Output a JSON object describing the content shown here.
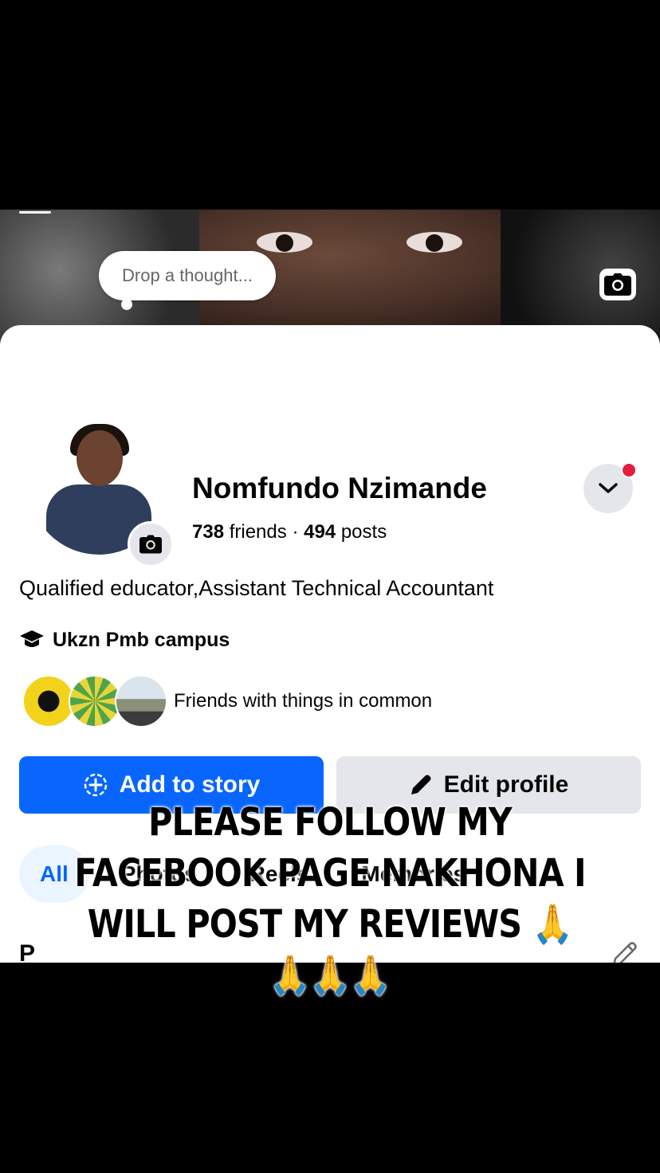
{
  "profile": {
    "thought_placeholder": "Drop a thought...",
    "name": "Nomfundo Nzimande",
    "friends_count": "738",
    "friends_label": "friends",
    "separator": "·",
    "posts_count": "494",
    "posts_label": "posts",
    "bio": "Qualified educator,Assistant Technical Accountant",
    "education": "Ukzn Pmb campus",
    "friends_in_common": "Friends with things in common"
  },
  "actions": {
    "add_story": "Add to story",
    "edit_profile": "Edit profile"
  },
  "tabs": [
    {
      "label": "All"
    },
    {
      "label": "Photos"
    },
    {
      "label": "Reels"
    },
    {
      "label": "Memories"
    }
  ],
  "section": {
    "title_partial": "P"
  },
  "overlay_text": "PLEASE FOLLOW MY FACEBOOK PAGE NAKHONA I WILL POST MY REVIEWS 🙏🙏🙏🙏",
  "colors": {
    "accent": "#0866ff",
    "notification": "#e41e3f",
    "secondary_button": "#e4e6eb"
  }
}
